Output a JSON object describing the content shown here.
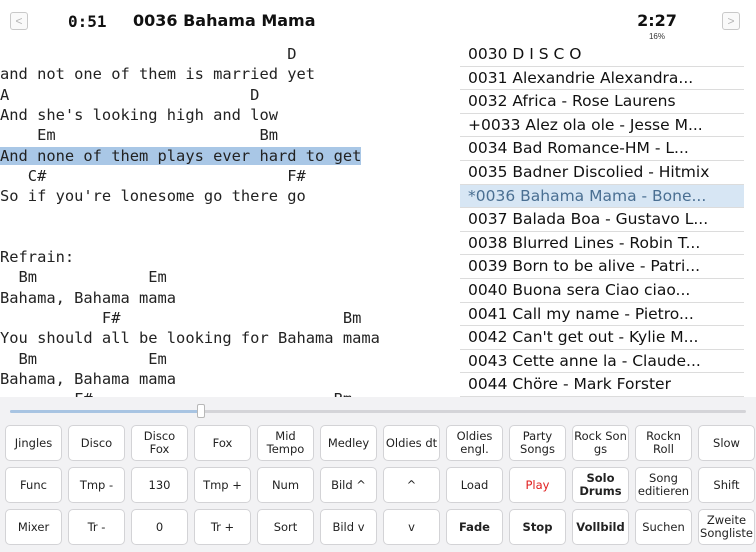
{
  "header": {
    "prev_symbol": "<",
    "next_symbol": ">",
    "elapsed": "0:51",
    "title": "0036 Bahama Mama",
    "duration": "2:27",
    "progress": "16%"
  },
  "lyrics": [
    {
      "text": "                               D",
      "highlight": false
    },
    {
      "text": "and not one of them is married yet",
      "highlight": false
    },
    {
      "text": "A                          D",
      "highlight": false
    },
    {
      "text": "And she's looking high and low",
      "highlight": false
    },
    {
      "text": "    Em                      Bm",
      "highlight": false
    },
    {
      "text": "And none of them plays ever hard to get",
      "highlight": true
    },
    {
      "text": "   C#                          F#",
      "highlight": false
    },
    {
      "text": "So if you're lonesome go there go",
      "highlight": false
    },
    {
      "text": "",
      "highlight": false
    },
    {
      "text": "",
      "highlight": false
    },
    {
      "text": "Refrain:",
      "highlight": false
    },
    {
      "text": "  Bm            Em",
      "highlight": false
    },
    {
      "text": "Bahama, Bahama mama",
      "highlight": false
    },
    {
      "text": "           F#                        Bm",
      "highlight": false
    },
    {
      "text": "You should all be looking for Bahama mama",
      "highlight": false
    },
    {
      "text": "  Bm            Em",
      "highlight": false
    },
    {
      "text": "Bahama, Bahama mama",
      "highlight": false
    },
    {
      "text": "        F#                          Bm",
      "highlight": false
    }
  ],
  "songlist": [
    {
      "label": "0030 D I S C O",
      "current": false
    },
    {
      "label": "0031 Alexandrie Alexandra...",
      "current": false
    },
    {
      "label": "0032 Africa - Rose Laurens",
      "current": false
    },
    {
      "label": "+0033 Alez ola ole - Jesse M...",
      "current": false
    },
    {
      "label": "0034 Bad Romance-HM - L...",
      "current": false
    },
    {
      "label": "0035 Badner Discolied - Hitmix",
      "current": false
    },
    {
      "label": "*0036 Bahama Mama - Bone...",
      "current": true
    },
    {
      "label": "0037 Balada Boa - Gustavo L...",
      "current": false
    },
    {
      "label": "0038 Blurred Lines - Robin T...",
      "current": false
    },
    {
      "label": "0039 Born to be alive - Patri...",
      "current": false
    },
    {
      "label": "0040 Buona sera Ciao ciao...",
      "current": false
    },
    {
      "label": "0041 Call my name - Pietro...",
      "current": false
    },
    {
      "label": "0042 Can't get out - Kylie M...",
      "current": false
    },
    {
      "label": "0043 Cette anne la - Claude...",
      "current": false
    },
    {
      "label": "0044 Chöre - Mark Forster",
      "current": false
    }
  ],
  "slider": {
    "position": 0.26
  },
  "buttons": [
    [
      {
        "label": "Jingles"
      },
      {
        "label": "Disco"
      },
      {
        "label": "Disco\nFox"
      },
      {
        "label": "Fox"
      },
      {
        "label": "Mid\nTempo"
      },
      {
        "label": "Medley"
      },
      {
        "label": "Oldies dt"
      },
      {
        "label": "Oldies\nengl."
      },
      {
        "label": "Party\nSongs"
      },
      {
        "label": "Rock Son\ngs"
      },
      {
        "label": "Rockn\nRoll"
      },
      {
        "label": "Slow"
      }
    ],
    [
      {
        "label": "Func"
      },
      {
        "label": "Tmp -"
      },
      {
        "label": "130"
      },
      {
        "label": "Tmp +"
      },
      {
        "label": "Num"
      },
      {
        "label": "Bild ^"
      },
      {
        "label": "^"
      },
      {
        "label": "Load"
      },
      {
        "label": "Play",
        "color": "red"
      },
      {
        "label": "Solo\nDrums",
        "bold": true
      },
      {
        "label": "Song\neditieren"
      },
      {
        "label": "Shift"
      }
    ],
    [
      {
        "label": "Mixer"
      },
      {
        "label": "Tr -"
      },
      {
        "label": "0"
      },
      {
        "label": "Tr +"
      },
      {
        "label": "Sort"
      },
      {
        "label": "Bild v"
      },
      {
        "label": "v"
      },
      {
        "label": "Fade",
        "bold": true
      },
      {
        "label": "Stop",
        "bold": true
      },
      {
        "label": "Vollbild",
        "bold": true
      },
      {
        "label": "Suchen"
      },
      {
        "label": "Zweite\nSongliste"
      }
    ]
  ]
}
